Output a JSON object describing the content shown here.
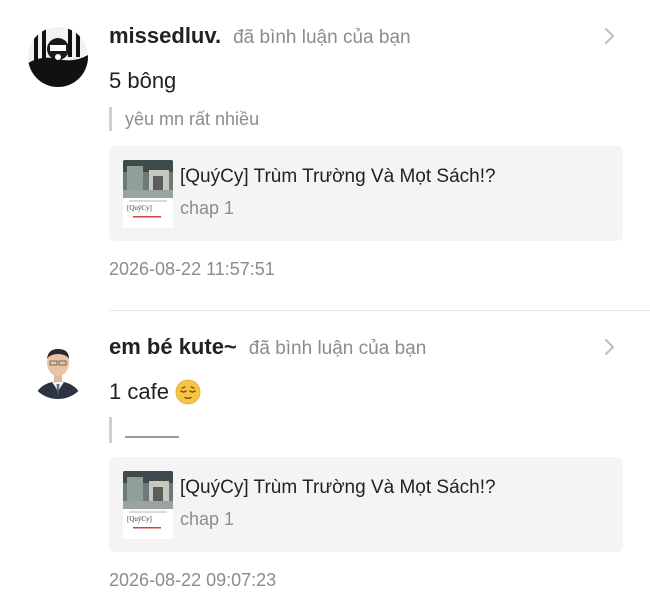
{
  "notifications": [
    {
      "username": "missedluv.",
      "action": "đã bình luận của bạn",
      "comment": "5 bông",
      "quote": "yêu mn rất nhiều",
      "ref_title": "[QuýCy] Trùm Trường Và Mọt Sách!?",
      "ref_sub": "chap 1",
      "thumb_label": "[QuýCy]",
      "time": "2026-08-22 11:57:51"
    },
    {
      "username": "em bé kute~",
      "action": "đã bình luận của bạn",
      "comment": "1 cafe",
      "emoji": "relieved-face",
      "quote": "",
      "ref_title": "[QuýCy] Trùm Trường Và Mọt Sách!?",
      "ref_sub": "chap 1",
      "thumb_label": "[QuýCy]",
      "time": "2026-08-22 09:07:23"
    }
  ],
  "colors": {
    "muted": "#8c8c8c",
    "card_bg": "#f4f4f4",
    "divider": "#e6e6e6"
  }
}
